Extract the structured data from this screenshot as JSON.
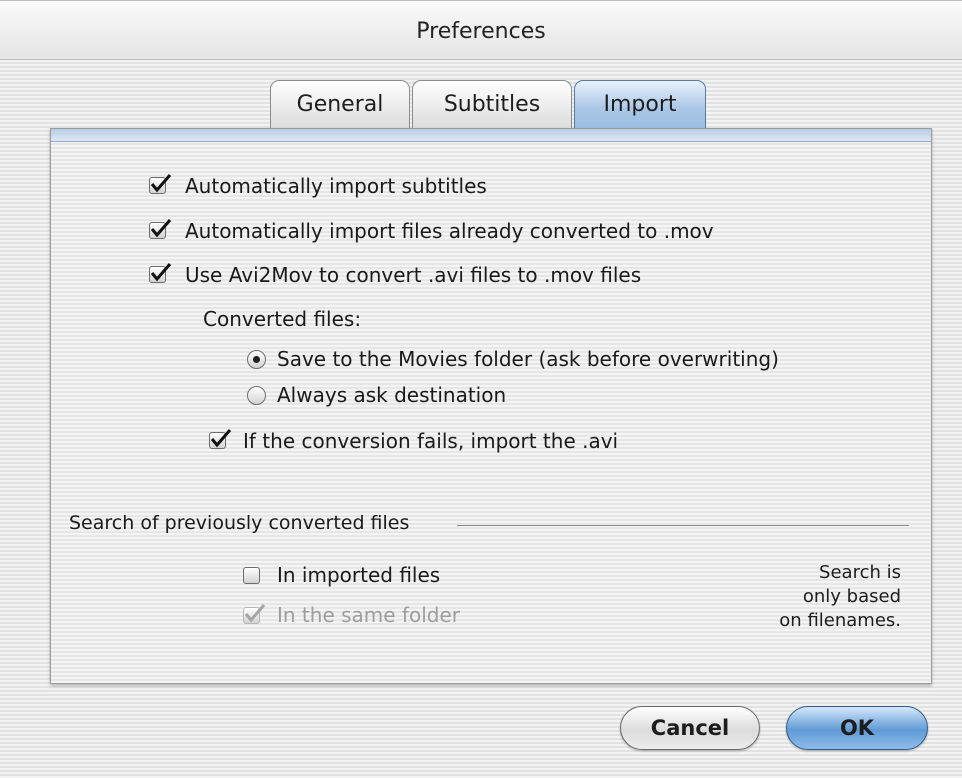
{
  "window": {
    "title": "Preferences"
  },
  "tabs": [
    {
      "label": "General",
      "active": false
    },
    {
      "label": "Subtitles",
      "active": false
    },
    {
      "label": "Import",
      "active": true
    }
  ],
  "options": {
    "auto_import_subtitles": {
      "label": "Automatically import subtitles",
      "checked": true
    },
    "auto_import_mov": {
      "label": "Automatically import files already converted to .mov",
      "checked": true
    },
    "use_avi2mov": {
      "label": "Use Avi2Mov to convert .avi files to .mov files",
      "checked": true
    }
  },
  "converted_files": {
    "heading": "Converted files:",
    "radios": [
      {
        "label": "Save to the Movies folder (ask before overwriting)",
        "selected": true
      },
      {
        "label": "Always ask destination",
        "selected": false
      }
    ],
    "fallback": {
      "label": "If the conversion fails, import the .avi",
      "checked": true
    }
  },
  "search": {
    "heading": "Search of previously converted files",
    "in_imported": {
      "label": "In imported files",
      "checked": false
    },
    "same_folder": {
      "label": "In the same folder",
      "checked": true,
      "enabled": false
    },
    "note_lines": [
      "Search is",
      "only based",
      "on filenames."
    ]
  },
  "buttons": {
    "cancel": "Cancel",
    "ok": "OK"
  },
  "colors": {
    "accent": "#7fb0e6",
    "tab_active": "#a9c6e6",
    "disabled_text": "#9d9d9d"
  }
}
